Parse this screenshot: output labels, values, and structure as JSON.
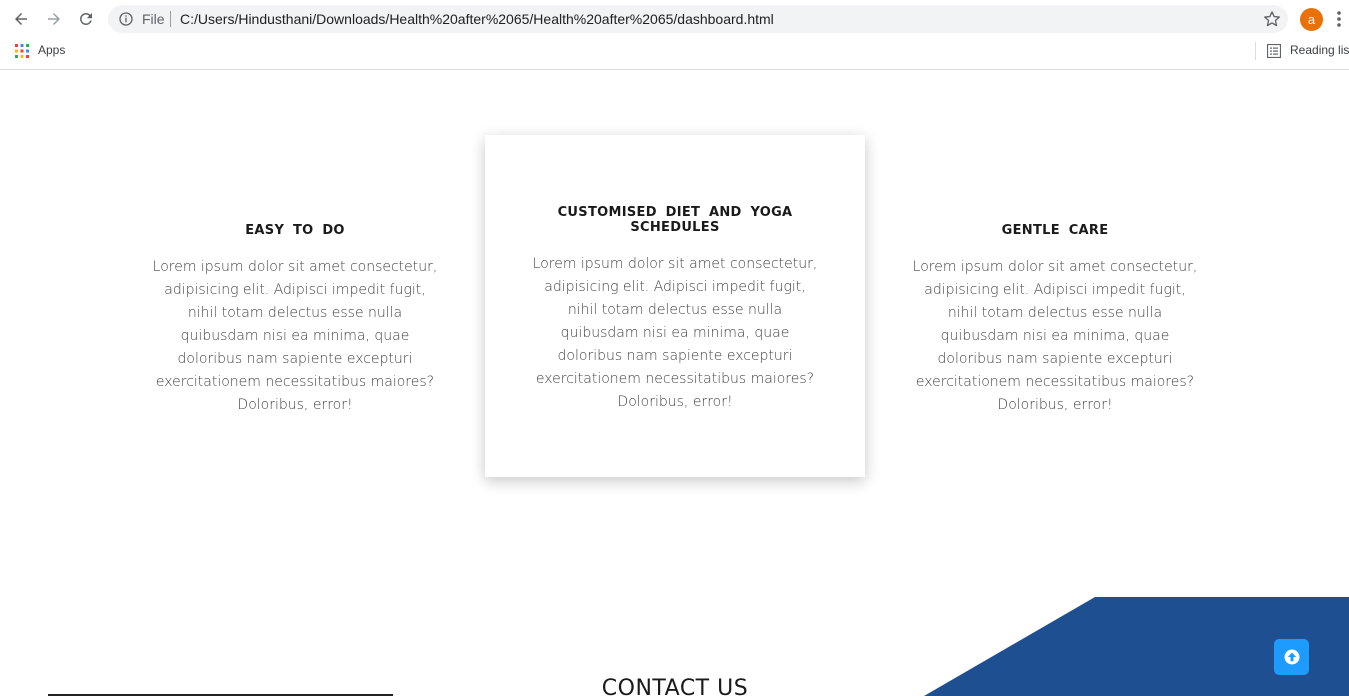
{
  "browser": {
    "url_scheme": "File",
    "url": "C:/Users/Hindusthani/Downloads/Health%20after%2065/Health%20after%2065/dashboard.html",
    "profile_initial": "a",
    "profile_color": "#e8710a",
    "bookmarks": {
      "apps_label": "Apps",
      "reading_list_label": "Reading list"
    }
  },
  "features": [
    {
      "title": "EASY TO DO",
      "text": "Lorem ipsum dolor sit amet consectetur, adipisicing elit. Adipisci impedit fugit, nihil totam delectus esse nulla quibusdam nisi ea minima, quae doloribus nam sapiente excepturi exercitationem necessitatibus maiores? Doloribus, error!"
    },
    {
      "title": "CUSTOMISED DIET AND YOGA SCHEDULES",
      "text": "Lorem ipsum dolor sit amet consectetur, adipisicing elit. Adipisci impedit fugit, nihil totam delectus esse nulla quibusdam nisi ea minima, quae doloribus nam sapiente excepturi exercitationem necessitatibus maiores? Doloribus, error!"
    },
    {
      "title": "GENTLE CARE",
      "text": "Lorem ipsum dolor sit amet consectetur, adipisicing elit. Adipisci impedit fugit, nihil totam delectus esse nulla quibusdam nisi ea minima, quae doloribus nam sapiente excepturi exercitationem necessitatibus maiores? Doloribus, error!"
    }
  ],
  "contact": {
    "title": "CONTACT US"
  },
  "colors": {
    "accent_blue": "#1e4f91",
    "scroll_button": "#1e9bff"
  },
  "icons": {
    "back": "back-arrow-icon",
    "forward": "forward-arrow-icon",
    "reload": "reload-icon",
    "info": "info-icon",
    "star": "star-icon",
    "menu": "kebab-menu-icon",
    "apps": "apps-grid-icon",
    "reading_list": "reading-list-icon",
    "scroll_top": "arrow-up-circle-icon"
  }
}
